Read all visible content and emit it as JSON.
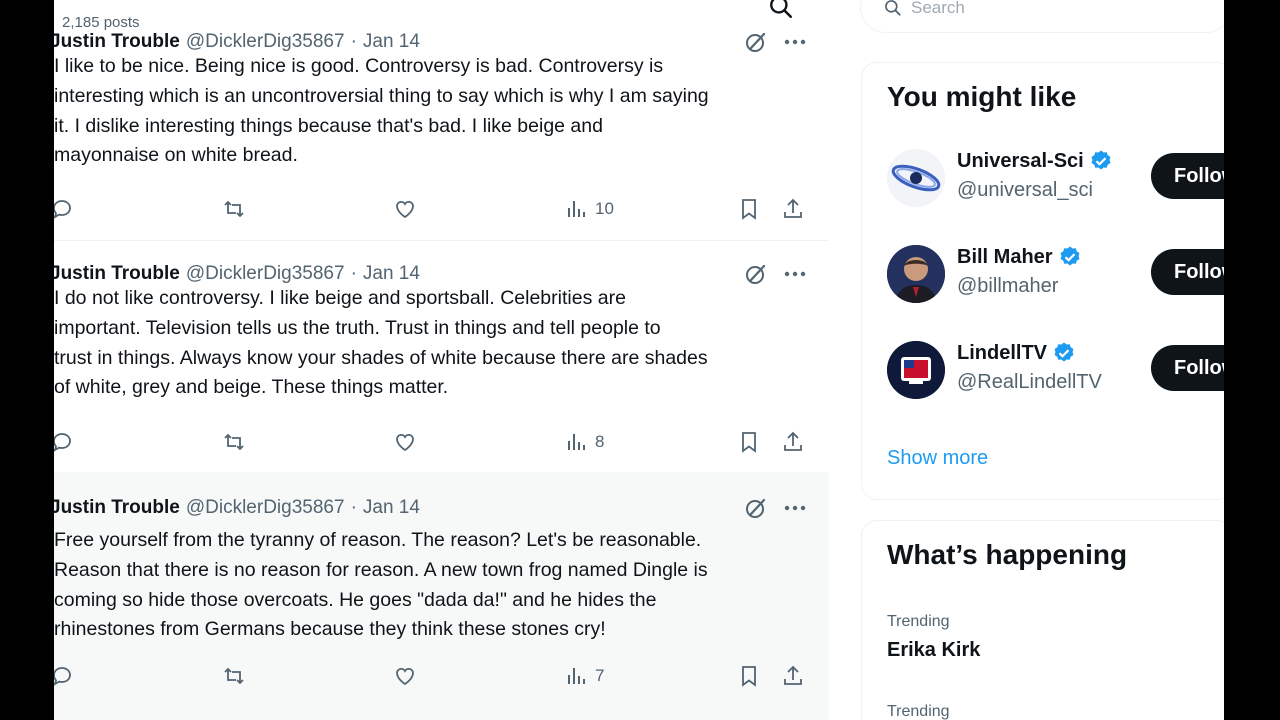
{
  "header": {
    "posts_count": "2,185 posts"
  },
  "tweets": [
    {
      "name": "Justin Trouble",
      "handle": "@DicklerDig35867",
      "separator": "·",
      "date": "Jan 14",
      "text": "I like to be nice. Being nice is good. Controversy is bad. Controversy is\ninteresting which is an uncontroversial thing to say which is why I am saying\nit. I dislike interesting things because that's bad. I like beige and\nmayonnaise on white bread.",
      "views": "10"
    },
    {
      "name": "Justin Trouble",
      "handle": "@DicklerDig35867",
      "separator": "·",
      "date": "Jan 14",
      "text": "I do not like controversy. I like beige and sportsball. Celebrities are\nimportant. Television tells us the truth. Trust in things and tell people to\ntrust in things. Always know your shades of white because there are shades\nof white, grey and beige. These things matter.",
      "views": "8"
    },
    {
      "name": "Justin Trouble",
      "handle": "@DicklerDig35867",
      "separator": "·",
      "date": "Jan 14",
      "text": "Free yourself from the tyranny of reason. The reason? Let's be reasonable.\nReason that there is no reason for reason. A new town frog named Dingle is\ncoming so hide those overcoats. He goes \"dada da!\" and he hides the\nrhinestones from Germans because they think these stones cry!",
      "views": "7"
    }
  ],
  "sidebar": {
    "search_placeholder": "Search",
    "you_might_like": {
      "title": "You might like",
      "accounts": [
        {
          "name": "Universal-Sci",
          "handle": "@universal_sci",
          "follow_label": "Follow",
          "verified": true
        },
        {
          "name": "Bill Maher",
          "handle": "@billmaher",
          "follow_label": "Follow",
          "verified": true
        },
        {
          "name": "LindellTV",
          "handle": "@RealLindellTV",
          "follow_label": "Follow",
          "verified": true
        }
      ],
      "show_more": "Show more"
    },
    "whats_happening": {
      "title": "What’s happening",
      "trends": [
        {
          "label": "Trending",
          "name": "Erika Kirk"
        },
        {
          "label": "Trending",
          "name": ""
        }
      ]
    }
  },
  "colors": {
    "accent": "#1d9bf0",
    "text_primary": "#0f1419",
    "text_secondary": "#536471",
    "follow_button": "#0f1419",
    "border": "#eff3f4"
  }
}
